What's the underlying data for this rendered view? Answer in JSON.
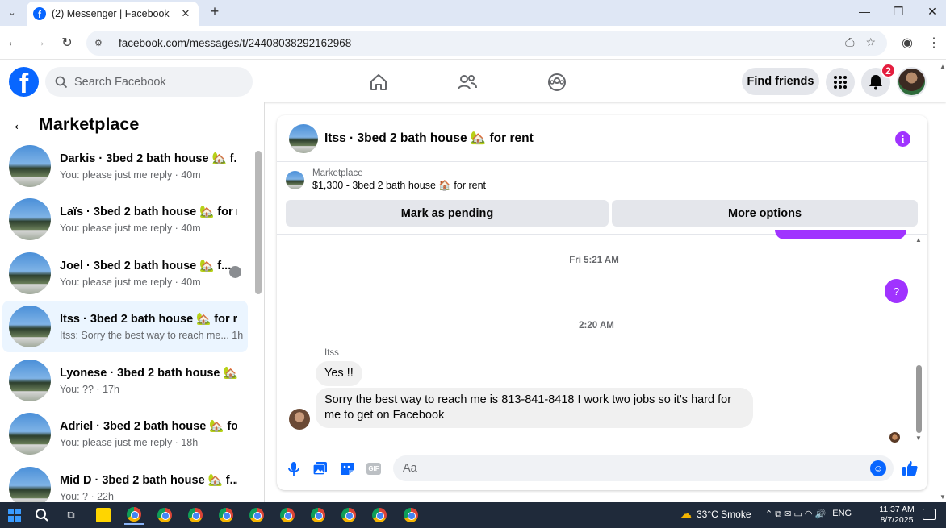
{
  "browser": {
    "tab_title": "(2) Messenger | Facebook",
    "tab_close": "✕",
    "new_tab": "+",
    "url": "facebook.com/messages/t/24408038292162968",
    "window_controls": [
      "—",
      "❐",
      "✕"
    ]
  },
  "header": {
    "logo": "f",
    "search_placeholder": "Search Facebook",
    "find_friends": "Find friends",
    "notification_count": "2",
    "nav_icons": [
      "home-icon",
      "friends-icon",
      "groups-icon"
    ]
  },
  "sidebar": {
    "title": "Marketplace",
    "back": "←",
    "conversations": [
      {
        "name": "Darkis · 3bed 2 bath house 🏡 f...",
        "preview": "You: please just me reply",
        "time": "40m",
        "active": false
      },
      {
        "name": "Laïs · 3bed 2 bath house 🏡 for r...",
        "preview": "You: please just me reply",
        "time": "40m",
        "active": false
      },
      {
        "name": "Joel · 3bed 2 bath house 🏡 f...",
        "preview": "You: please just me reply",
        "time": "40m",
        "active": false
      },
      {
        "name": "Itss · 3bed 2 bath house 🏡 for r...",
        "preview": "Itss: Sorry the best way to reach me...",
        "time": "1h",
        "active": true
      },
      {
        "name": "Lyonese · 3bed 2 bath house 🏡 ...",
        "preview": "You: ??",
        "time": "17h",
        "active": false
      },
      {
        "name": "Adriel · 3bed 2 bath house 🏡 fo...",
        "preview": "You: please just me reply",
        "time": "18h",
        "active": false
      },
      {
        "name": "Mid D · 3bed 2 bath house 🏡 f...",
        "preview": "You: ?",
        "time": "22h",
        "active": false
      }
    ]
  },
  "chat": {
    "title": "Itss · 3bed 2 bath house 🏡 for rent",
    "info": "i",
    "listing_category": "Marketplace",
    "listing_desc": "$1,300 - 3bed 2 bath house 🏠 for rent",
    "mark_pending": "Mark as pending",
    "more_options": "More options",
    "timestamp1": "Fri 5:21 AM",
    "outgoing_q": "?",
    "timestamp2": "2:20 AM",
    "sender_name": "Itss",
    "msg1": "Yes !!",
    "msg2": "Sorry the best way to reach me is 813-841-8418 I work two jobs so it's hard for me to get on Facebook",
    "input_placeholder": "Aa",
    "emoji": "☺",
    "composer_icons": [
      "mic-icon",
      "photo-icon",
      "sticker-icon",
      "gif-icon"
    ],
    "gif_label": "GIF"
  },
  "taskbar": {
    "weather": "33°C  Smoke",
    "lang": "ENG",
    "time": "11:37 AM",
    "date": "8/7/2025",
    "tray": "⌃  ⧉  ✉  ▭  ◠  🔊"
  },
  "colors": {
    "accent": "#a033ff",
    "fb_blue": "#0866ff"
  }
}
